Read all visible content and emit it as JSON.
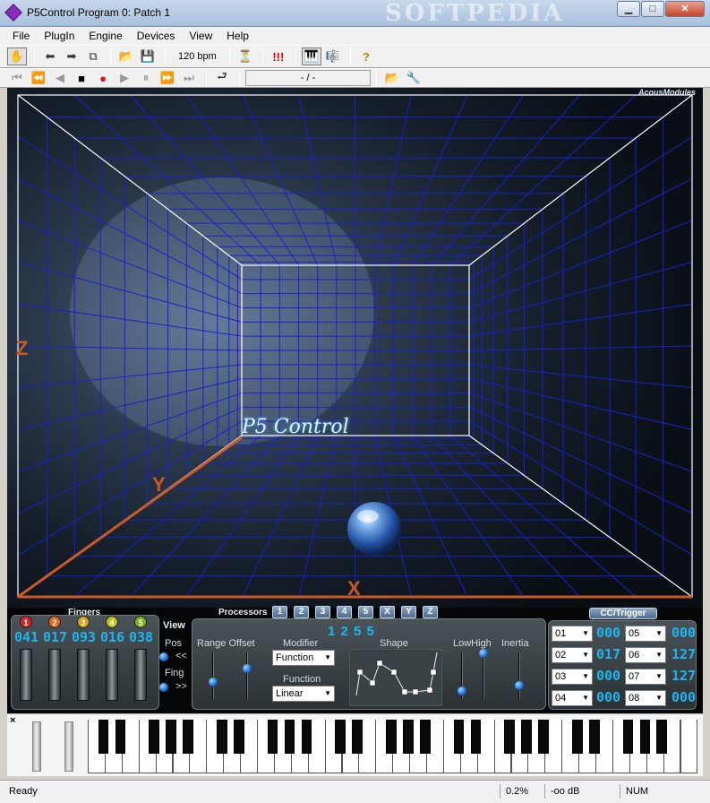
{
  "window": {
    "title": "P5Control Program 0: Patch   1",
    "watermark": "SOFTPEDIA",
    "min_label": "▁",
    "max_label": "□",
    "close_label": "✕"
  },
  "menu": [
    "File",
    "PlugIn",
    "Engine",
    "Devices",
    "View",
    "Help"
  ],
  "toolbar": {
    "tempo": "120 bpm",
    "position": "- / -",
    "alarm": "!!!",
    "help": "?"
  },
  "viewport": {
    "brand": "AcousModules",
    "logo_text": "P5 Control",
    "axis_x": "X",
    "axis_y": "Y",
    "axis_z": "Z"
  },
  "fingers": {
    "label": "Fingers",
    "items": [
      {
        "n": "1",
        "value": "041",
        "color": "#d7262b"
      },
      {
        "n": "2",
        "value": "017",
        "color": "#e06a1a"
      },
      {
        "n": "3",
        "value": "093",
        "color": "#d9a21a"
      },
      {
        "n": "4",
        "value": "016",
        "color": "#bcc41a"
      },
      {
        "n": "5",
        "value": "038",
        "color": "#7ab31c"
      }
    ]
  },
  "view": {
    "label": "View",
    "pos_label": "Pos",
    "pos_btn": "<<",
    "fing_label": "Fing",
    "fing_btn": ">>"
  },
  "processors": {
    "label": "Processors",
    "tabs": [
      "1",
      "2",
      "3",
      "4",
      "5",
      "X",
      "Y",
      "Z"
    ],
    "active_indicator": "1 2 5 5",
    "range_offset_label": "Range Offset",
    "modifier_label": "Modifier",
    "modifier_value": "Function",
    "function_label": "Function",
    "function_value": "Linear",
    "shape_label": "Shape",
    "lowhigh_label": "LowHigh",
    "inertia_label": "Inertia"
  },
  "cc": {
    "label": "CC/Trigger",
    "rows": [
      {
        "left_ch": "01",
        "left_val": "000",
        "right_ch": "05",
        "right_val": "000"
      },
      {
        "left_ch": "02",
        "left_val": "017",
        "right_ch": "06",
        "right_val": "127"
      },
      {
        "left_ch": "03",
        "left_val": "000",
        "right_ch": "07",
        "right_val": "127"
      },
      {
        "left_ch": "04",
        "left_val": "000",
        "right_ch": "08",
        "right_val": "000"
      }
    ]
  },
  "piano": {
    "close_label": "×"
  },
  "status": {
    "ready": "Ready",
    "cpu": "0.2%",
    "level": "-oo dB",
    "num": "NUM"
  },
  "colors": {
    "grid": "#1a22c8",
    "axis": "#c85a28",
    "digits": "#1eb6f0"
  }
}
